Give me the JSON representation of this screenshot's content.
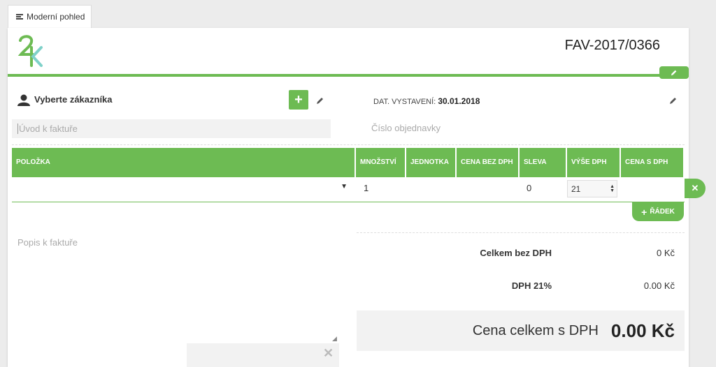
{
  "tab": {
    "label": "Moderní pohled"
  },
  "invoice": {
    "number": "FAV-2017/0366"
  },
  "customer": {
    "label": "Vyberte zákazníka",
    "add_label": "+"
  },
  "date": {
    "label": "DAT. VYSTAVENÍ:",
    "value": "30.01.2018"
  },
  "intro": {
    "placeholder": "Úvod k faktuře"
  },
  "order": {
    "placeholder": "Číslo objednavky"
  },
  "table": {
    "headers": [
      "POLOŽKA",
      "MNOŽSTVÍ",
      "JEDNOTKA",
      "CENA BEZ DPH",
      "SLEVA",
      "VÝŠE DPH",
      "CENA S DPH"
    ],
    "row": {
      "item": "",
      "quantity": "1",
      "unit": "",
      "price": "",
      "discount": "0",
      "vat": "21",
      "price_vat": ""
    },
    "add_row_label": "ŘÁDEK"
  },
  "description": {
    "placeholder": "Popis k faktuře"
  },
  "summary": {
    "subtotal_label": "Celkem bez DPH",
    "subtotal_value": "0 Kč",
    "vat_label": "DPH 21%",
    "vat_value": "0.00 Kč",
    "total_label": "Cena celkem s DPH",
    "total_value": "0.00 Kč"
  },
  "colors": {
    "accent": "#6dbb53",
    "logo_green": "#6dbb53",
    "logo_teal": "#7fd1c9"
  }
}
